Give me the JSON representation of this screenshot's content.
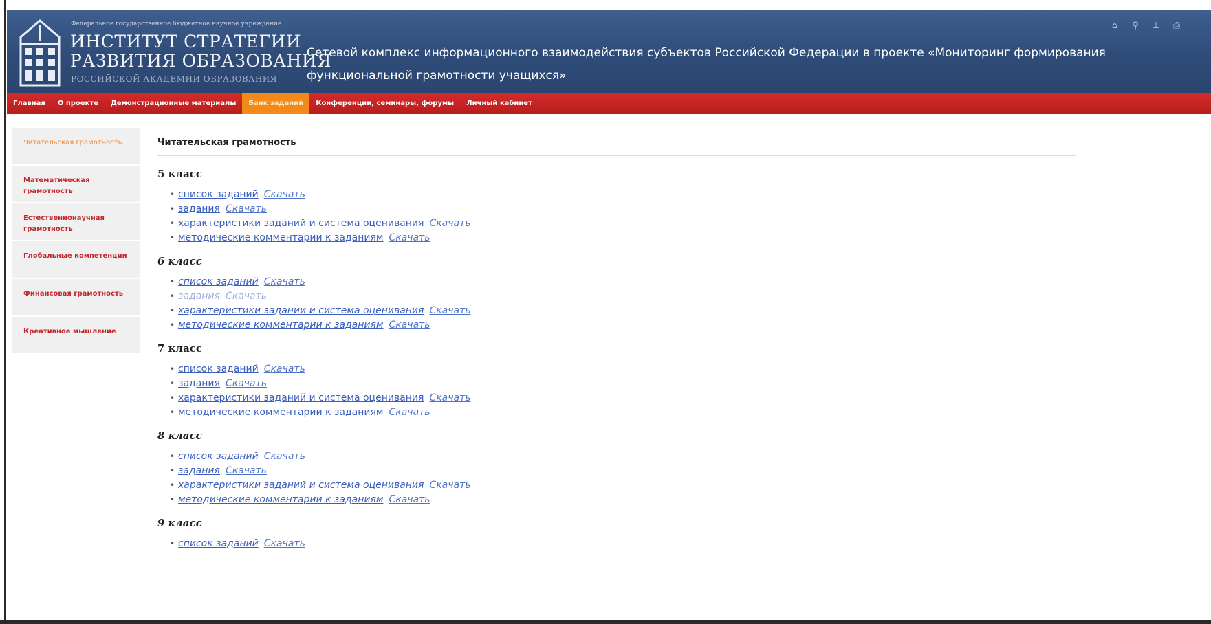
{
  "header": {
    "institution_small": "Федеральное государственное бюджетное научное учреждение",
    "institution_line1": "ИНСТИТУТ СТРАТЕГИИ",
    "institution_line2": "РАЗВИТИЯ ОБРАЗОВАНИЯ",
    "institution_line3": "РОССИЙСКОЙ АКАДЕМИИ ОБРАЗОВАНИЯ",
    "site_title_line1": "Сетевой комплекс информационного взаимодействия субъектов Российской Федерации в проекте «Мониторинг формирования",
    "site_title_line2": "функциональной грамотности учащихся»",
    "icons": [
      "home-icon",
      "search-icon",
      "sitemap-icon",
      "print-icon"
    ]
  },
  "nav": {
    "items": [
      {
        "label": "Главная"
      },
      {
        "label": "О проекте"
      },
      {
        "label": "Демонстрационные материалы"
      },
      {
        "label": "Банк заданий"
      },
      {
        "label": "Конференции, семинары, форумы"
      },
      {
        "label": "Личный кабинет"
      }
    ],
    "active_index": 3
  },
  "sidebar": {
    "items": [
      {
        "label": "Читательская грамотность"
      },
      {
        "label": "Математическая грамотность"
      },
      {
        "label": "Естественнонаучная грамотность"
      },
      {
        "label": "Глобальные компетенции"
      },
      {
        "label": "Финансовая грамотность"
      },
      {
        "label": "Креативное мышление"
      }
    ],
    "active_index": 0
  },
  "main": {
    "title": "Читательская грамотность",
    "download_label": "Скачать",
    "grades": [
      {
        "label": "5 класс",
        "items": [
          "список заданий",
          "задания",
          "характеристики заданий и система оценивания",
          "методические комментарии к заданиям"
        ]
      },
      {
        "label": "6 класс",
        "items": [
          "список заданий",
          "задания",
          "характеристики заданий и система оценивания",
          "методические комментарии к заданиям"
        ]
      },
      {
        "label": "7 класс",
        "items": [
          "список заданий",
          "задания",
          "характеристики заданий и система оценивания",
          "методические комментарии к заданиям"
        ]
      },
      {
        "label": "8 класс",
        "items": [
          "список заданий",
          "задания",
          "характеристики заданий и система оценивания",
          "методические комментарии к заданиям"
        ]
      },
      {
        "label": "9 класс",
        "items": [
          "список заданий"
        ]
      }
    ]
  },
  "colors": {
    "header_bg": "#2f4c79",
    "nav_bg": "#c82424",
    "nav_active": "#f28a1a",
    "sidebar_text": "#c3262d",
    "sidebar_active_text": "#ee8a3a",
    "link": "#3b5fbe"
  }
}
